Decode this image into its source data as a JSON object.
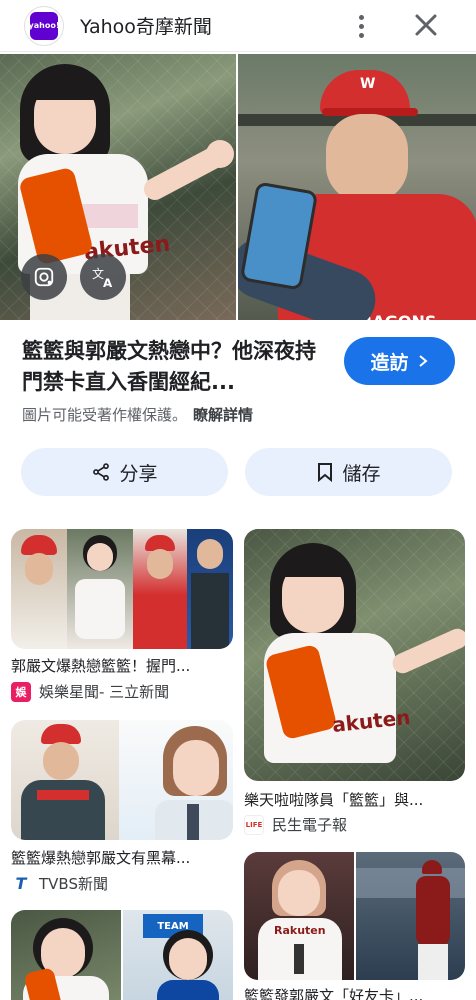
{
  "topbar": {
    "logo_text": "yahoo!",
    "title": "Yahoo奇摩新聞",
    "icons": [
      "more-vert-icon",
      "close-icon"
    ]
  },
  "hero": {
    "left_image": "cheerleader-photo",
    "right_image": "baseball-player-photo",
    "lens_icon": "google-lens-icon",
    "translate_icon": "translate-icon"
  },
  "result": {
    "headline": "籃籃與郭嚴文熱戀中？他深夜持門禁卡直入香閨經紀...",
    "visit_label": "造訪",
    "copyright_text": "圖片可能受著作權保護。",
    "learn_more": "瞭解詳情"
  },
  "actions": {
    "share_label": "分享",
    "save_label": "儲存"
  },
  "related": [
    {
      "caption": "郭嚴文爆熱戀籃籃！握門...",
      "source": "娛樂星聞- 三立新聞",
      "favicon": "娛",
      "favicon_color": "#e91e63"
    },
    {
      "caption": "樂天啦啦隊員「籃籃」與...",
      "source": "民生電子報",
      "favicon": "LIFE",
      "favicon_color": "#d93025"
    },
    {
      "caption": "籃籃爆熱戀郭嚴文有黑幕...",
      "source": "TVBS新聞",
      "favicon": "T",
      "favicon_color": "#1a5fb4"
    },
    {
      "caption": "籃籃發郭嚴文「好友卡」...",
      "source": "",
      "favicon": "",
      "favicon_color": ""
    },
    {
      "caption": "",
      "source": "",
      "favicon": "",
      "favicon_color": ""
    }
  ],
  "colors": {
    "accent": "#1a73e8",
    "action_bg": "#e8f0fe",
    "yahoo_purple": "#6001d2"
  }
}
